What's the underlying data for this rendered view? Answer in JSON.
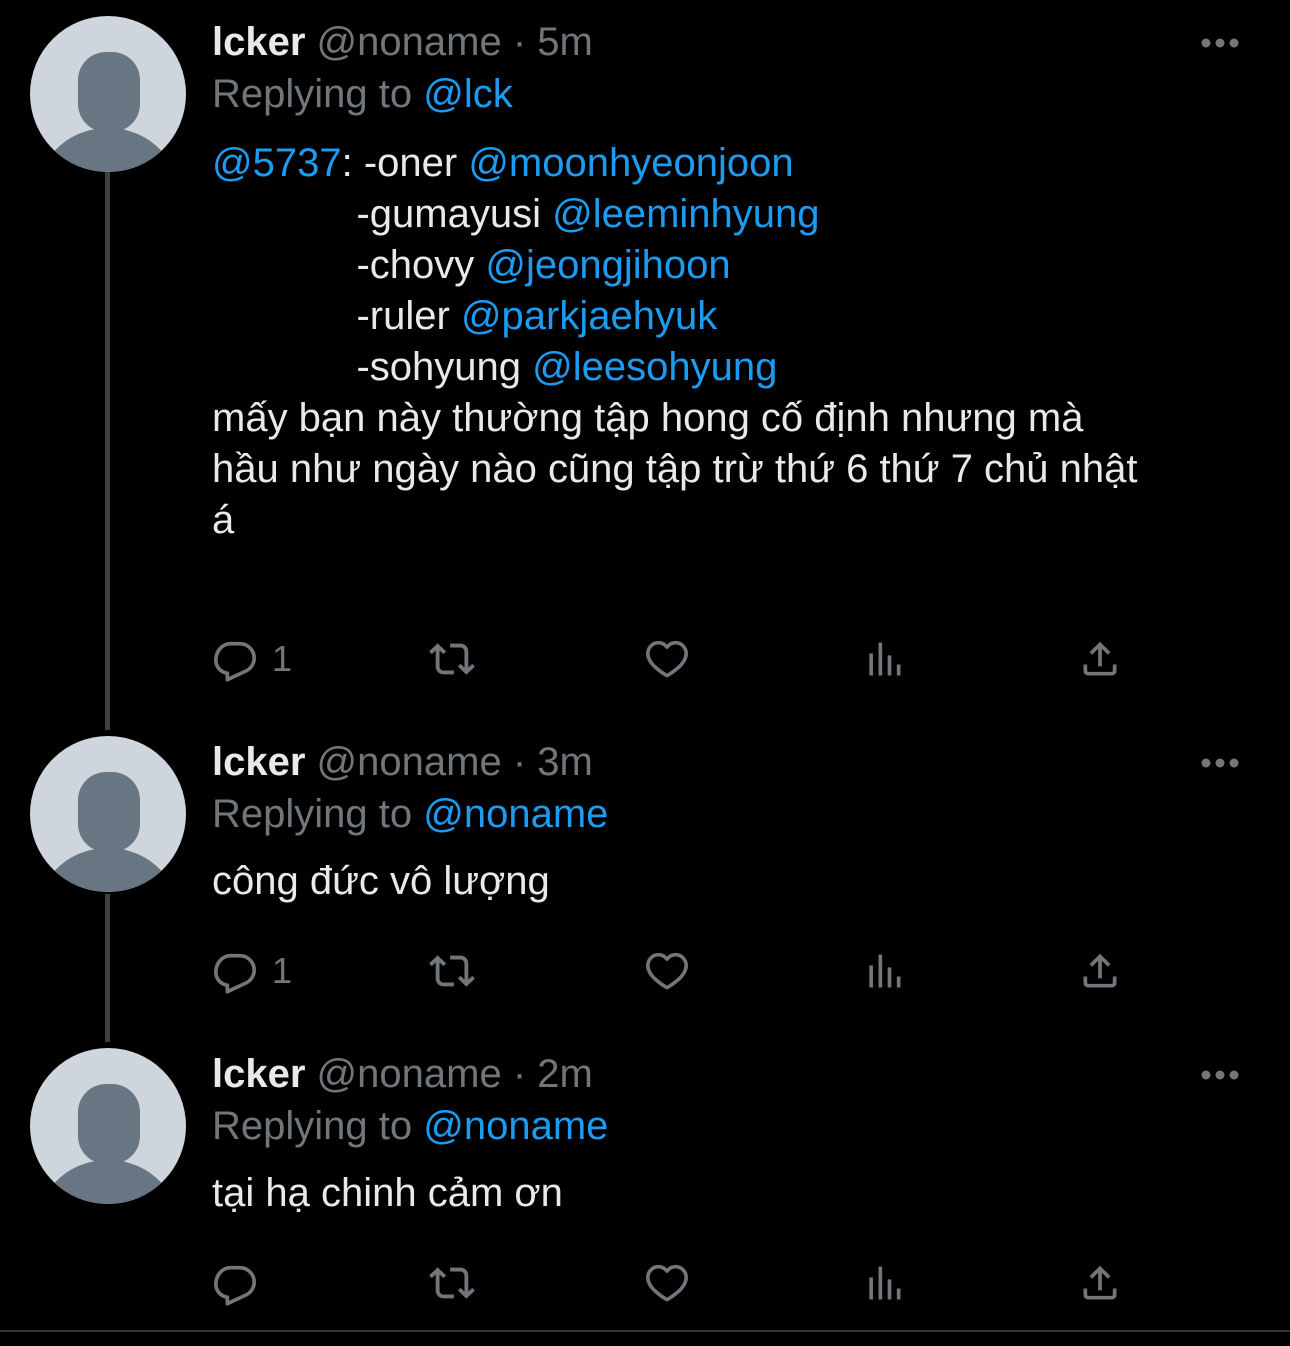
{
  "tweets": [
    {
      "name": "lcker",
      "handle": "@noname",
      "separator": "·",
      "time": "5m",
      "replying_prefix": "Replying to",
      "replying_to": "@lck",
      "body_lines": [
        [
          {
            "t": "@5737",
            "m": true
          },
          {
            "t": ": -oner "
          },
          {
            "t": "@moonhyeonjoon",
            "m": true
          }
        ],
        [
          {
            "t": "             -gumayusi "
          },
          {
            "t": "@leeminhyung",
            "m": true
          }
        ],
        [
          {
            "t": "             -chovy "
          },
          {
            "t": "@jeongjihoon",
            "m": true
          }
        ],
        [
          {
            "t": "             -ruler "
          },
          {
            "t": "@parkjaehyuk",
            "m": true
          }
        ],
        [
          {
            "t": "             -sohyung "
          },
          {
            "t": "@leesohyung",
            "m": true
          }
        ],
        [
          {
            "t": "mấy bạn này thường tập hong cố định nhưng mà"
          }
        ],
        [
          {
            "t": "hầu như ngày nào cũng tập trừ thứ 6 thứ 7 chủ nhật"
          }
        ],
        [
          {
            "t": "á"
          }
        ]
      ],
      "reply_count": "1"
    },
    {
      "name": "lcker",
      "handle": "@noname",
      "separator": "·",
      "time": "3m",
      "replying_prefix": "Replying to",
      "replying_to": "@noname",
      "body_lines": [
        [
          {
            "t": "công đức vô lượng"
          }
        ]
      ],
      "reply_count": "1"
    },
    {
      "name": "lcker",
      "handle": "@noname",
      "separator": "·",
      "time": "2m",
      "replying_prefix": "Replying to",
      "replying_to": "@noname",
      "body_lines": [
        [
          {
            "t": "tại hạ chinh cảm ơn"
          }
        ]
      ],
      "reply_count": ""
    }
  ],
  "icons": {
    "reply": "reply-icon",
    "retweet": "retweet-icon",
    "like": "heart-icon",
    "views": "views-icon",
    "share": "share-icon",
    "more": "more-icon"
  },
  "colors": {
    "background": "#000000",
    "text": "#e7e9ea",
    "secondary": "#71767b",
    "accent": "#1d9bf0",
    "avatar_bg": "#ced5dc",
    "avatar_fg": "#687684",
    "thread_line": "#3e4144"
  }
}
